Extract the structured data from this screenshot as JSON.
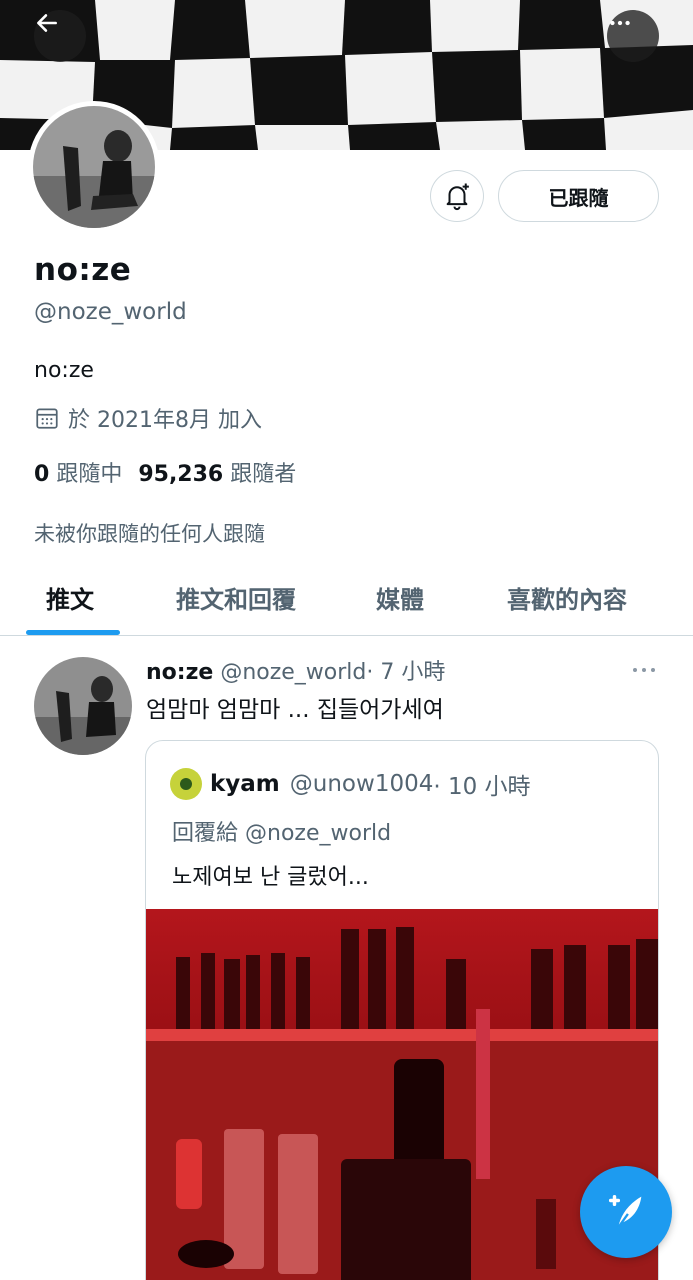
{
  "profile": {
    "display_name": "no:ze",
    "handle": "@noze_world",
    "bio": "no:ze",
    "joined": "於 2021年8月 加入",
    "following_count": "0",
    "following_label": "跟隨中",
    "followers_count": "95,236",
    "followers_label": "跟隨者",
    "followed_by_text": "未被你跟隨的任何人跟隨",
    "following_button": "已跟隨"
  },
  "tabs": [
    {
      "label": "推文",
      "active": true
    },
    {
      "label": "推文和回覆",
      "active": false
    },
    {
      "label": "媒體",
      "active": false
    },
    {
      "label": "喜歡的內容",
      "active": false
    }
  ],
  "tweet": {
    "name": "no:ze",
    "handle": "@noze_world",
    "time": "· 7 小時",
    "text": "엄맘마 엄맘마 ... 집들어가세여",
    "quoted": {
      "name": "kyam",
      "handle": "@unow1004",
      "time": "· 10 小時",
      "reply_prefix": "回覆給",
      "reply_to": "@noze_world",
      "text": "노제여보 난 글렀어..."
    }
  },
  "icons": {
    "back": "arrow-left-icon",
    "more": "more-horizontal-icon",
    "bell": "bell-plus-icon",
    "calendar": "calendar-icon",
    "compose": "compose-feather-icon"
  },
  "colors": {
    "accent": "#1d9bf0",
    "text_primary": "#0f1419",
    "text_secondary": "#536471",
    "border": "#cfd9de"
  }
}
